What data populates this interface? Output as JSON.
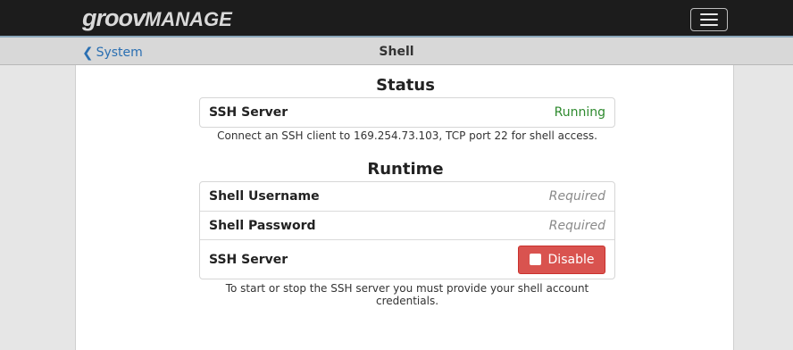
{
  "header": {
    "logo_part1": "groov",
    "logo_part2": "MANAGE"
  },
  "nav": {
    "back_label": "System",
    "title": "Shell"
  },
  "status": {
    "title": "Status",
    "ssh_label": "SSH Server",
    "ssh_value": "Running",
    "ssh_value_color": "#2e8a2e",
    "note": "Connect an SSH client to 169.254.73.103, TCP port 22 for shell access."
  },
  "runtime": {
    "title": "Runtime",
    "username_label": "Shell Username",
    "username_placeholder": "Required",
    "password_label": "Shell Password",
    "password_placeholder": "Required",
    "ssh_label": "SSH Server",
    "disable_label": "Disable",
    "disable_color": "#d9534f",
    "note_line1": "To start or stop the SSH server you must provide your shell account",
    "note_line2": "credentials."
  }
}
